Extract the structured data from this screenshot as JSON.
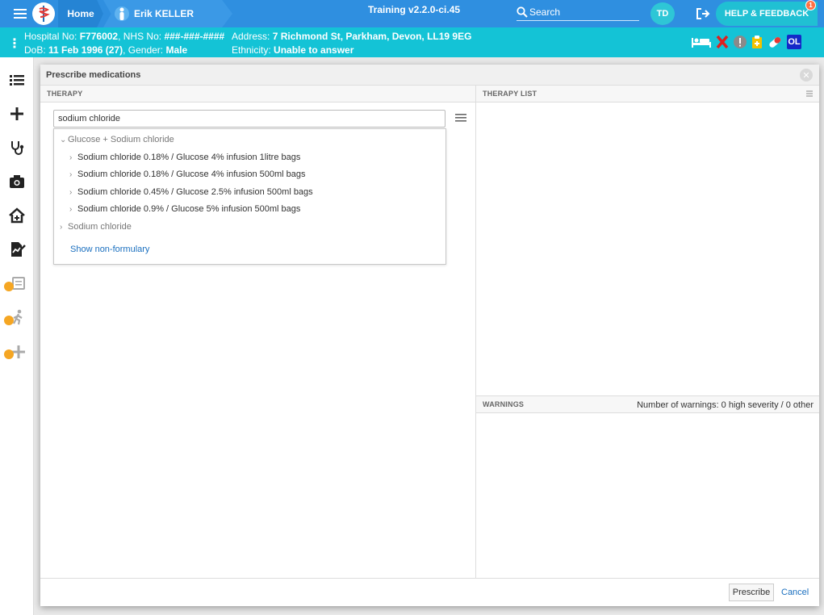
{
  "topbar": {
    "home_label": "Home",
    "patient_name": "Erik KELLER",
    "version": "Training v2.2.0-ci.45",
    "search_label": "Search",
    "user_initials": "TD",
    "help_label": "HELP & FEEDBACK",
    "help_badge": "1"
  },
  "banner": {
    "hospital_label": "Hospital No:",
    "hospital_no": "F776002",
    "nhs_label": "NHS No:",
    "nhs_no": "###-###-####",
    "dob_label": "DoB:",
    "dob": "11 Feb 1996 (27)",
    "gender_label": "Gender:",
    "gender": "Male",
    "address_label": "Address:",
    "address": "7 Richmond St, Parkham, Devon, LL19 9EG",
    "ethnicity_label": "Ethnicity:",
    "ethnicity": "Unable to answer",
    "ol_badge": "OL"
  },
  "dialog": {
    "title": "Prescribe medications",
    "therapy_header": "THERAPY",
    "therapy_list_header": "THERAPY LIST",
    "warnings_header": "WARNINGS",
    "warnings_count": "Number of warnings: 0 high severity / 0 other",
    "search_value": "sodium chloride",
    "results": {
      "group1": "Glucose + Sodium chloride",
      "items": [
        "Sodium chloride 0.18% / Glucose 4% infusion 1litre bags",
        "Sodium chloride 0.18% / Glucose 4% infusion 500ml bags",
        "Sodium chloride 0.45% / Glucose 2.5% infusion 500ml bags",
        "Sodium chloride 0.9% / Glucose 5% infusion 500ml bags"
      ],
      "group2": "Sodium chloride",
      "show_non_formulary": "Show non-formulary"
    },
    "prescribe_label": "Prescribe",
    "cancel_label": "Cancel"
  },
  "colors": {
    "topbar": "#2f8fe0",
    "banner": "#14c3d6",
    "link": "#1a6fbf",
    "lock": "#f5a623"
  }
}
